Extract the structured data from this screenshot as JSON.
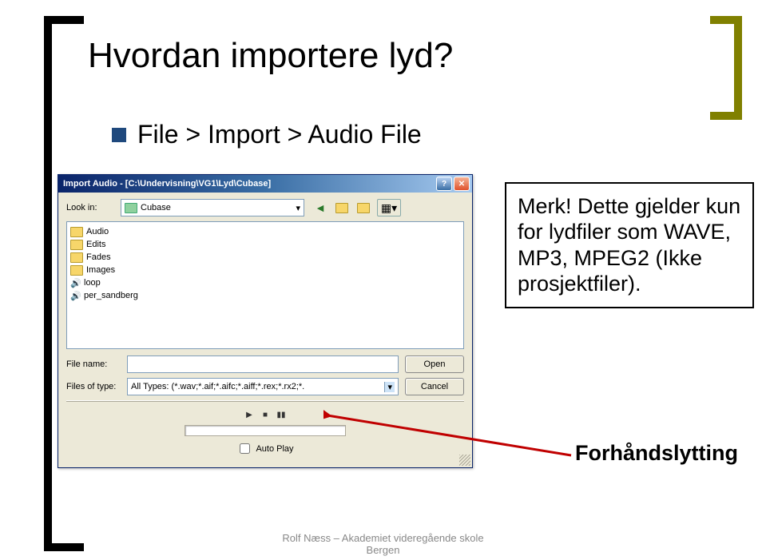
{
  "slide": {
    "title": "Hvordan importere lyd?",
    "bullet": "File > Import > Audio File"
  },
  "dialog": {
    "title": "Import Audio - [C:\\Undervisning\\VG1\\Lyd\\Cubase]",
    "lookin_label": "Look in:",
    "lookin_value": "Cubase",
    "files": [
      {
        "name": "Audio",
        "type": "folder"
      },
      {
        "name": "Edits",
        "type": "folder"
      },
      {
        "name": "Fades",
        "type": "folder"
      },
      {
        "name": "Images",
        "type": "folder"
      },
      {
        "name": "loop",
        "type": "sound"
      },
      {
        "name": "per_sandberg",
        "type": "sound"
      }
    ],
    "filename_label": "File name:",
    "filename_value": "",
    "filetype_label": "Files of type:",
    "filetype_value": "All Types: (*.wav;*.aif;*.aifc;*.aiff;*.rex;*.rx2;*.",
    "open_btn": "Open",
    "cancel_btn": "Cancel",
    "autoplay_label": "Auto Play"
  },
  "note": {
    "text": "Merk! Dette gjelder kun for lydfiler som WAVE, MP3, MPEG2 (Ikke prosjektfiler)."
  },
  "preview_label": "Forhåndslytting",
  "footer": {
    "line1": "Rolf Næss – Akademiet videregående skole",
    "line2": "Bergen"
  }
}
